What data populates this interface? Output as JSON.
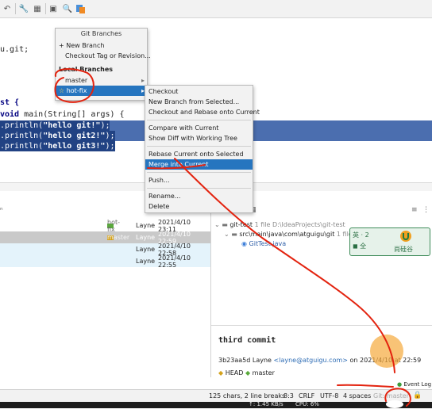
{
  "toolbar": {
    "icons": [
      "undo-icon",
      "wrench-icon",
      "structure-icon",
      "window-icon",
      "search-icon",
      "vcs-icon"
    ]
  },
  "editor": {
    "lines": [
      {
        "text": "u.git;"
      },
      {
        "text": "st {"
      },
      {
        "prefix": "void ",
        "rest": "main(String[] args) {"
      },
      {
        "pre": ".println(",
        "str": "\"hello git!\"",
        "post": ");"
      },
      {
        "pre": ".println(",
        "str": "\"hello git2!\"",
        "post": ");"
      },
      {
        "pre": ".println(",
        "str": "\"hello git3!\"",
        "post": ");"
      }
    ]
  },
  "git_branches_popup": {
    "title": "Git Branches",
    "new_branch": "+ New Branch",
    "checkout_tag": "Checkout Tag or Revision...",
    "local_header": "Local Branches",
    "branches": [
      "master",
      "hot-fix"
    ]
  },
  "branch_submenu": {
    "items": [
      "Checkout",
      "New Branch from Selected...",
      "Checkout and Rebase onto Current",
      "Compare with Current",
      "Show Diff with Working Tree",
      "Rebase Current onto Selected",
      "Merge into Current",
      "Push...",
      "Rename...",
      "Delete"
    ]
  },
  "log": {
    "rows": [
      {
        "tag": "hot-fix",
        "author": "Layne",
        "date": "2021/4/10 23:11"
      },
      {
        "tag": "master",
        "author": "Layne",
        "date": "2021/4/10 22:59"
      },
      {
        "tag": "",
        "author": "Layne",
        "date": "2021/4/10 22:58"
      },
      {
        "tag": "",
        "author": "Layne",
        "date": "2021/4/10 22:55"
      }
    ]
  },
  "changes_tree": {
    "root": "git-test",
    "root_suffix": "1 file D:\\IdeaProjects\\git-test",
    "folder": "src\\main\\java\\com\\atguigu\\git",
    "folder_suffix": "1 file",
    "file": "GitTest.java"
  },
  "commit_details": {
    "message": "third commit",
    "hash": "3b23aa5d",
    "author": "Layne",
    "email": "<layne@atguigu.com>",
    "on": "on 2021/4/10 at 22:59",
    "refs": [
      "HEAD",
      "master"
    ]
  },
  "watermark": {
    "text_left_top": "英 · 2",
    "text_left_bottom": "◼ 全",
    "brand": "尚硅谷"
  },
  "status_bar": {
    "chars": "125 chars, 2 line breaks",
    "pos": "8:3",
    "line_sep": "CRLF",
    "encoding": "UTF-8",
    "indent": "4 spaces",
    "branch": "Git: master",
    "event_log": "Event Log"
  },
  "taskbar": {
    "net": "↑: 1.45 KB/s",
    "cpu": "CPU: 6%"
  },
  "colors": {
    "selection": "#214283",
    "menu_highlight": "#2675bf",
    "annotation": "#e3230f",
    "string": "#008000"
  }
}
